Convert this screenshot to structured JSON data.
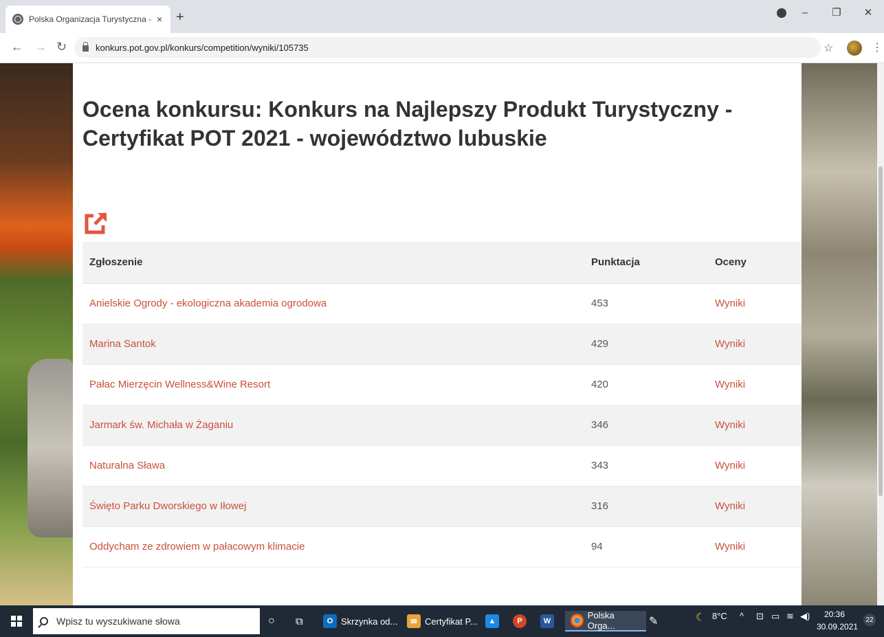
{
  "browser": {
    "tab_title": "Polska Organizacja Turystyczna -",
    "tab_close": "×",
    "new_tab": "+",
    "url": "konkurs.pot.gov.pl/konkurs/competition/wyniki/105735",
    "controls": {
      "minimize": "–",
      "maximize": "❐",
      "close": "✕"
    }
  },
  "page": {
    "title": "Ocena konkursu: Konkurs na Najlepszy Produkt Turystyczny - Certyfikat POT 2021 - województwo lubuskie",
    "columns": {
      "entry": "Zgłoszenie",
      "score": "Punktacja",
      "ratings": "Oceny"
    },
    "rows": [
      {
        "name": "Anielskie Ogrody - ekologiczna akademia ogrodowa",
        "score": "453",
        "link": "Wyniki"
      },
      {
        "name": "Marina Santok",
        "score": "429",
        "link": "Wyniki"
      },
      {
        "name": "Pałac Mierzęcin Wellness&Wine Resort",
        "score": "420",
        "link": "Wyniki"
      },
      {
        "name": "Jarmark św. Michała w Żaganiu",
        "score": "346",
        "link": "Wyniki"
      },
      {
        "name": "Naturalna Sława",
        "score": "343",
        "link": "Wyniki"
      },
      {
        "name": "Święto Parku Dworskiego w Iłowej",
        "score": "316",
        "link": "Wyniki"
      },
      {
        "name": "Oddycham ze zdrowiem w pałacowym klimacie",
        "score": "94",
        "link": "Wyniki"
      }
    ],
    "accent_color": "#c9503c"
  },
  "taskbar": {
    "search_placeholder": "Wpisz tu wyszukiwane słowa",
    "apps": [
      {
        "label": "Skrzynka od...",
        "icon": "outlook-icon"
      },
      {
        "label": "Certyfikat P...",
        "icon": "mail-icon"
      },
      {
        "label": "Polska Orga...",
        "icon": "chrome-icon"
      }
    ],
    "weather": "8°C",
    "time": "20:36",
    "date": "30.09.2021",
    "notifications": "22"
  }
}
